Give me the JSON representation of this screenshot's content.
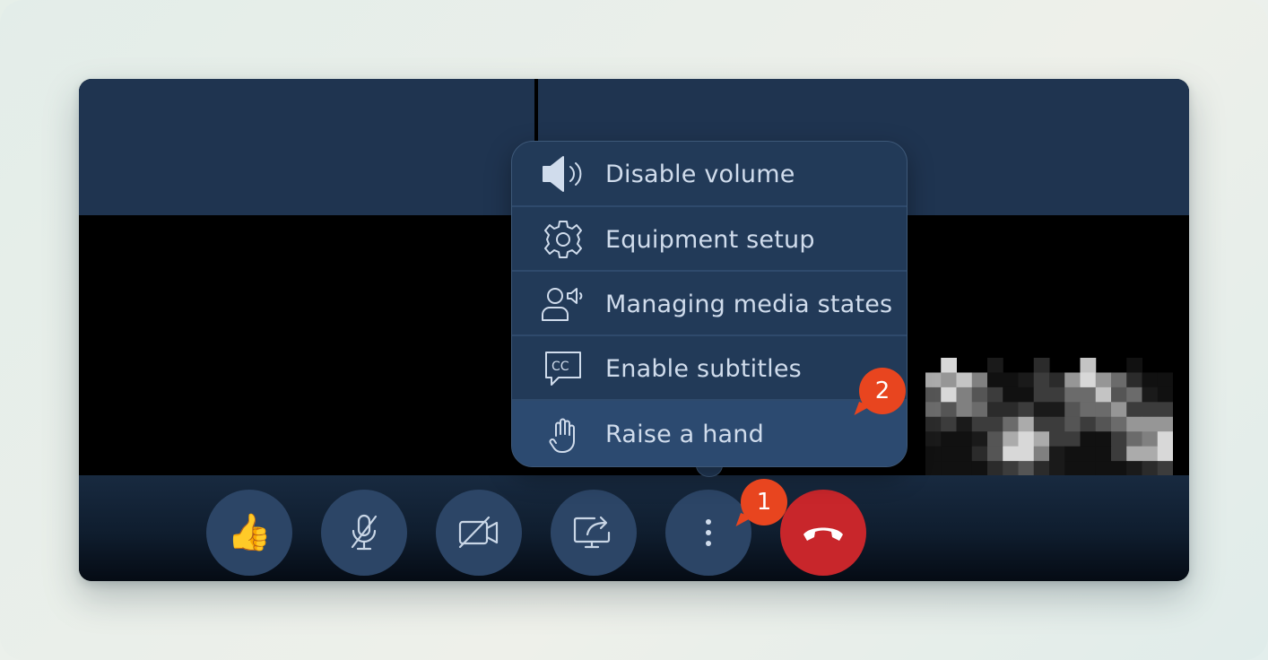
{
  "menu": {
    "items": [
      {
        "label": "Disable volume",
        "icon": "speaker-icon"
      },
      {
        "label": "Equipment setup",
        "icon": "gear-icon"
      },
      {
        "label": "Managing media states",
        "icon": "participant-media-icon"
      },
      {
        "label": "Enable subtitles",
        "icon": "cc-subtitles-icon"
      },
      {
        "label": "Raise a hand",
        "icon": "hand-icon"
      }
    ],
    "highlighted_index": 4
  },
  "controls": [
    {
      "name": "reaction",
      "icon": "thumbs-up-icon",
      "glyph": "👍"
    },
    {
      "name": "microphone",
      "icon": "microphone-muted-icon"
    },
    {
      "name": "camera",
      "icon": "camera-off-icon"
    },
    {
      "name": "screen-share",
      "icon": "screen-share-icon"
    },
    {
      "name": "more",
      "icon": "more-vertical-icon"
    },
    {
      "name": "hang-up",
      "icon": "phone-hangup-icon"
    }
  ],
  "badges": [
    {
      "number": "1"
    },
    {
      "number": "2"
    }
  ],
  "colors": {
    "panel": "#223a58",
    "button": "#2c4566",
    "hangup": "#c8262b",
    "badge": "#e8451f",
    "menu_text": "#d0dcec"
  }
}
